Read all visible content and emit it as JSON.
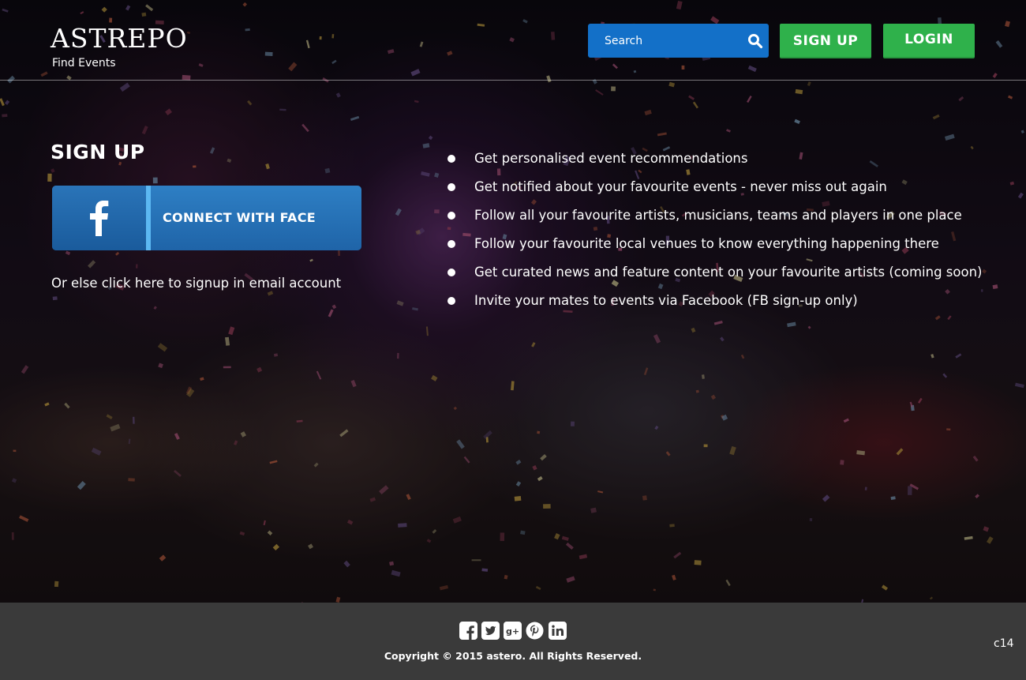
{
  "header": {
    "logo": "ASTREPO",
    "tagline": "Find Events",
    "search": {
      "placeholder": "Search",
      "value": ""
    },
    "signup_label": "SIGN UP",
    "login_label": "LOGIN"
  },
  "signup": {
    "title": "SIGN UP",
    "facebook_button_label": "CONNECT WITH FACE BOOK",
    "email_link": "Or else click here to signup in email account"
  },
  "benefits": [
    "Get personalised event recommendations",
    "Get notified about your favourite events - never miss out again",
    "Follow all your favourite artists, musicians, teams and players in one place",
    "Follow your favourite local venues to know everything happening there",
    "Get curated news and feature content on your favourite artists (coming soon)",
    "Invite your mates to events via Facebook (FB sign-up only)"
  ],
  "footer": {
    "social_icons": [
      "facebook-icon",
      "twitter-icon",
      "google-plus-icon",
      "pinterest-icon",
      "linkedin-icon"
    ],
    "copyright": "Copyright © 2015 astero. All Rights Reserved.",
    "build": "c14"
  },
  "colors": {
    "search_bg": "#1370c8",
    "green_button": "#2fb14b",
    "facebook_blue": "#2a74b8",
    "facebook_separator": "#5cb8f2",
    "footer_bg": "#3a3a3a"
  }
}
